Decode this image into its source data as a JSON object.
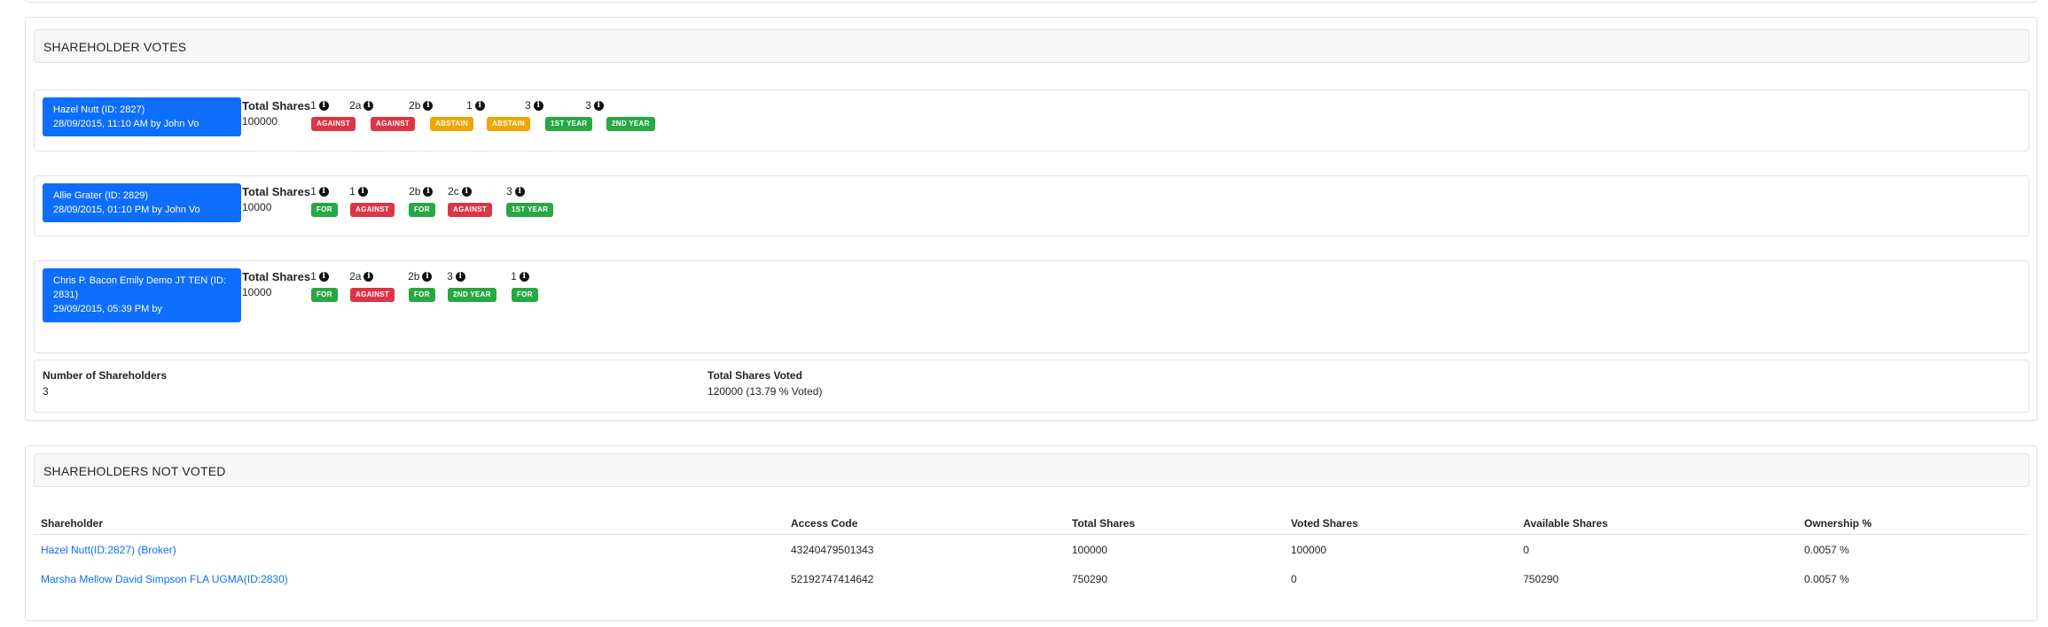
{
  "votes_panel": {
    "title": "SHAREHOLDER VOTES",
    "cards": [
      {
        "holder_line1": "Hazel Nutt (ID: 2827)",
        "holder_line2": "28/09/2015, 11:10 AM by John Vo",
        "total_label": "Total Shares",
        "total_value": "100000",
        "votes": [
          {
            "q": "1",
            "vote": "AGAINST",
            "color": "#dc3545"
          },
          {
            "q": "2a",
            "vote": "AGAINST",
            "color": "#dc3545"
          },
          {
            "q": "2b",
            "vote": "ABSTAIN",
            "color": "#f0a500"
          },
          {
            "q": "1",
            "vote": "ABSTAIN",
            "color": "#f0a500"
          },
          {
            "q": "3",
            "vote": "1ST YEAR",
            "color": "#28a745"
          },
          {
            "q": "3",
            "vote": "2ND YEAR",
            "color": "#28a745"
          }
        ]
      },
      {
        "holder_line1": "Allie Grater (ID: 2829)",
        "holder_line2": "28/09/2015, 01:10 PM by John Vo",
        "total_label": "Total Shares",
        "total_value": "10000",
        "votes": [
          {
            "q": "1",
            "vote": "FOR",
            "color": "#28a745"
          },
          {
            "q": "1",
            "vote": "AGAINST",
            "color": "#dc3545"
          },
          {
            "q": "2b",
            "vote": "FOR",
            "color": "#28a745"
          },
          {
            "q": "2c",
            "vote": "AGAINST",
            "color": "#dc3545"
          },
          {
            "q": "3",
            "vote": "1ST YEAR",
            "color": "#28a745"
          }
        ]
      },
      {
        "holder_line1": "Chris P. Bacon Emily Demo JT TEN (ID:",
        "holder_line2": "2831)",
        "holder_line3": "29/09/2015, 05:39 PM by",
        "total_label": "Total Shares",
        "total_value": "10000",
        "votes": [
          {
            "q": "1",
            "vote": "FOR",
            "color": "#28a745"
          },
          {
            "q": "2a",
            "vote": "AGAINST",
            "color": "#dc3545"
          },
          {
            "q": "2b",
            "vote": "FOR",
            "color": "#28a745"
          },
          {
            "q": "3",
            "vote": "2ND YEAR",
            "color": "#28a745"
          },
          {
            "q": "1",
            "vote": "FOR",
            "color": "#28a745"
          }
        ]
      }
    ],
    "summary": {
      "num_label": "Number of Shareholders",
      "num_value": "3",
      "voted_label": "Total Shares Voted",
      "voted_value": "120000 (13.79 % Voted)"
    }
  },
  "not_voted_panel": {
    "title": "SHAREHOLDERS NOT VOTED",
    "columns": [
      "Shareholder",
      "Access Code",
      "Total Shares",
      "Voted Shares",
      "Available Shares",
      "Ownership %"
    ],
    "rows": [
      [
        "Hazel Nutt(ID:2827) (Broker)",
        "43240479501343",
        "100000",
        "100000",
        "0",
        "0.0057 %"
      ],
      [
        "Marsha Mellow David Simpson FLA UGMA(ID:2830)",
        "52192747414642",
        "750290",
        "0",
        "750290",
        "0.0057 %"
      ]
    ]
  },
  "icons": {
    "info": "info-circle-icon"
  }
}
